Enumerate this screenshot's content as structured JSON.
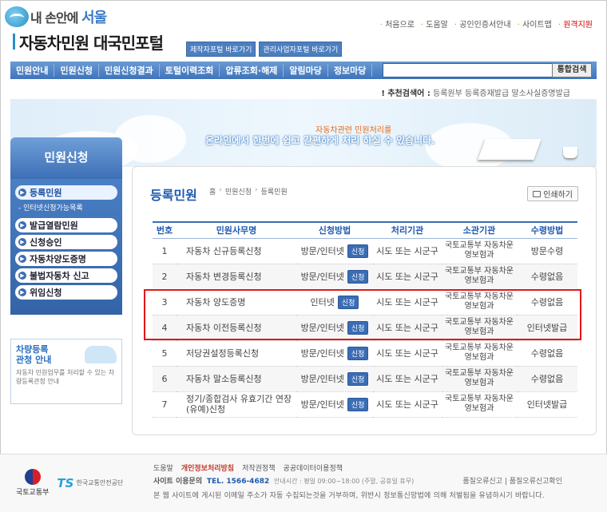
{
  "header": {
    "slogan_prefix": "내 손안에",
    "slogan_city": "서울",
    "portal_title": "자동차민원 대국민포털",
    "quick_buttons": [
      "제작자포털 바로가기",
      "관리사업자포털 바로가기"
    ],
    "top_links": [
      "처음으로",
      "도움말",
      "공인인증서안내",
      "사이트맵",
      "원격지원"
    ]
  },
  "nav": {
    "items": [
      "민원안내",
      "민원신청",
      "민원신청결과",
      "토털이력조회",
      "압류조회·해제",
      "알림마당",
      "정보마당"
    ],
    "search_placeholder": "",
    "search_button": "통합검색"
  },
  "recommend": {
    "label": "추천검색어 :",
    "terms": "등록원부  등록증재발급  말소사실증명발급"
  },
  "banner": {
    "line1": "자동차관련 민원처리를",
    "line2": "온라인에서 한번에 쉽고 간편하게 처리 하실 수 있습니다."
  },
  "sidebar": {
    "title": "민원신청",
    "items": [
      "등록민원",
      "발급열람민원",
      "신청승인",
      "자동차양도증명",
      "불법자동차 신고",
      "위임신청"
    ],
    "sub_item": "인터넷신청가능목록",
    "info_title": "차량등록\n관청 안내",
    "info_text": "자동차 민원업무를 처리할 수 있는 차량등록관청 안내"
  },
  "content": {
    "title": "등록민원",
    "breadcrumb": [
      "홈",
      "민원신청",
      "등록민원"
    ],
    "print_label": "인쇄하기",
    "columns": [
      "번호",
      "민원사무명",
      "신청방법",
      "처리기관",
      "소관기관",
      "수령방법"
    ],
    "badge_label": "신청",
    "rows": [
      {
        "no": "1",
        "name": "자동차 신규등록신청",
        "method": "방문/인터넷",
        "agency": "시도 또는 시군구",
        "authority": "국토교통부 자동차운영보험과",
        "receive": "방문수령"
      },
      {
        "no": "2",
        "name": "자동차 변경등록신청",
        "method": "방문/인터넷",
        "agency": "시도 또는 시군구",
        "authority": "국토교통부 자동차운영보험과",
        "receive": "수령없음"
      },
      {
        "no": "3",
        "name": "자동차 양도증명",
        "method": "인터넷",
        "agency": "시도 또는 시군구",
        "authority": "국토교통부 자동차운영보험과",
        "receive": "수령없음"
      },
      {
        "no": "4",
        "name": "자동차 이전등록신청",
        "method": "방문/인터넷",
        "agency": "시도 또는 시군구",
        "authority": "국토교통부 자동차운영보험과",
        "receive": "인터넷발급"
      },
      {
        "no": "5",
        "name": "저당권설정등록신청",
        "method": "방문/인터넷",
        "agency": "시도 또는 시군구",
        "authority": "국토교통부 자동차운영보험과",
        "receive": "수령없음"
      },
      {
        "no": "6",
        "name": "자동차 말소등록신청",
        "method": "방문/인터넷",
        "agency": "시도 또는 시군구",
        "authority": "국토교통부 자동차운영보험과",
        "receive": "수령없음"
      },
      {
        "no": "7",
        "name": "정기/종합검사 유효기간 연장(유예)신청",
        "method": "방문/인터넷",
        "agency": "시도 또는 시군구",
        "authority": "국토교통부 자동차운영보험과",
        "receive": "인터넷발급"
      }
    ]
  },
  "footer": {
    "molit": "국토교통부",
    "ts_mark": "TS",
    "ts_name": "한국교통안전공단",
    "links": [
      "도움말",
      "개인정보처리방침",
      "저작권정책",
      "공공데이터이용정책"
    ],
    "contact_label": "사이트 이용문의",
    "tel": "TEL. 1566-4682",
    "hours": "안내시간 : 평일 09:00~18:00 (주말, 공휴일 휴무)",
    "quality": "품질오류신고 | 품질오류신고확인",
    "notice": "본 웹 사이트에 게시된 이메일 주소가 자동 수집되는것을 거부하며, 위반시 정보통신망법에 의해 처벌됨을 유념하시기 바랍니다."
  }
}
